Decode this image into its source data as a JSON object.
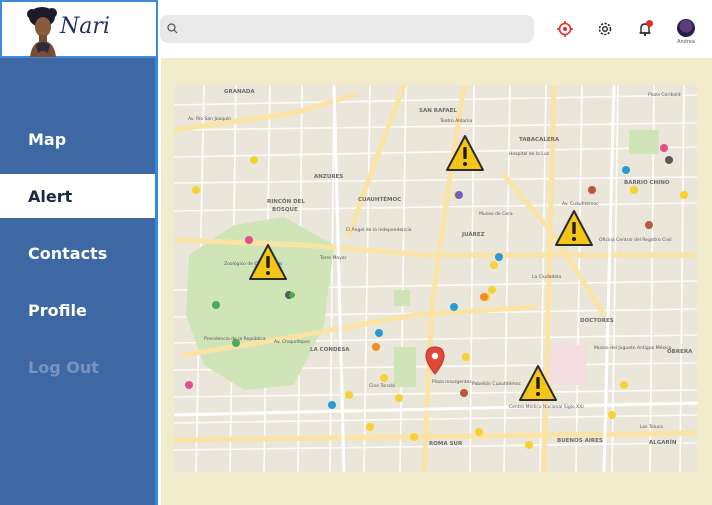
{
  "app": {
    "logo_text": "Nari"
  },
  "nav": [
    {
      "id": "map",
      "label": "Map"
    },
    {
      "id": "alert",
      "label": "Alert",
      "active": true
    },
    {
      "id": "contacts",
      "label": "Contacts"
    },
    {
      "id": "profile",
      "label": "Profile"
    },
    {
      "id": "logout",
      "label": "Log Out"
    }
  ],
  "search": {
    "placeholder": ""
  },
  "header": {
    "icons": [
      "location-target-icon",
      "gear-icon",
      "bell-icon"
    ],
    "notification_dot": true,
    "avatar_name": "Andrea"
  },
  "map": {
    "alert_markers": 4,
    "labels": {
      "granada": "GRANADA",
      "san_rafael": "SAN RAFAEL",
      "tabacalera": "TABACALERA",
      "anzures": "ANZURES",
      "rincon": "RINCÓN DEL",
      "bosque": "BOSQUE",
      "cuauhtemoc": "CUAUHTÉMOC",
      "barrio_chino": "BARRIO CHINO",
      "juarez": "JUÁREZ",
      "doctores": "DOCTORES",
      "la_condesa": "LA CONDESA",
      "obrera": "OBRERA",
      "roma_sur": "ROMA SUR",
      "buenos_aires": "BUENOS AIRES",
      "algarin": "ALGARÍN",
      "teatro_aldama": "Teatro Aldama",
      "hospital_luz": "Hospital de la Luz",
      "museo_cera": "Museo de Cera",
      "angel": "El Ángel de la Independencia",
      "zoologico": "Zoológico de Chapultepec",
      "torre_mayor": "Torre Mayor",
      "plaza_insurgentes": "Plaza Insurgentes",
      "presidencia": "Presidencia de la República",
      "museo_juguete": "Museo del Juguete Antiguo México",
      "centro_medico": "Centro Médico Nacional Siglo XXI",
      "oficina_registro": "Oficina Central del Registro Civil",
      "plaza_garibaldi": "Plaza Garibaldi",
      "av_rio_san_joaquin": "Av. Río San Joaquín",
      "av_chapultepec": "Av. Chapultepec",
      "av_cuauhtemoc": "Av. Cuauhtémoc",
      "la_ciudadela": "La Ciudadela",
      "cine_tonala": "Cine Tonalá",
      "pabellon_cuauhtemoc": "Pabellón Cuauhtémoc",
      "los_toluca": "Los Toluca"
    }
  },
  "colors": {
    "sidebar": "#3e68a4",
    "sidebar_border": "#2f8ce0",
    "main_bg": "#f2ebcc",
    "alert_yellow": "#f5c518",
    "pin_red": "#e0483a"
  }
}
